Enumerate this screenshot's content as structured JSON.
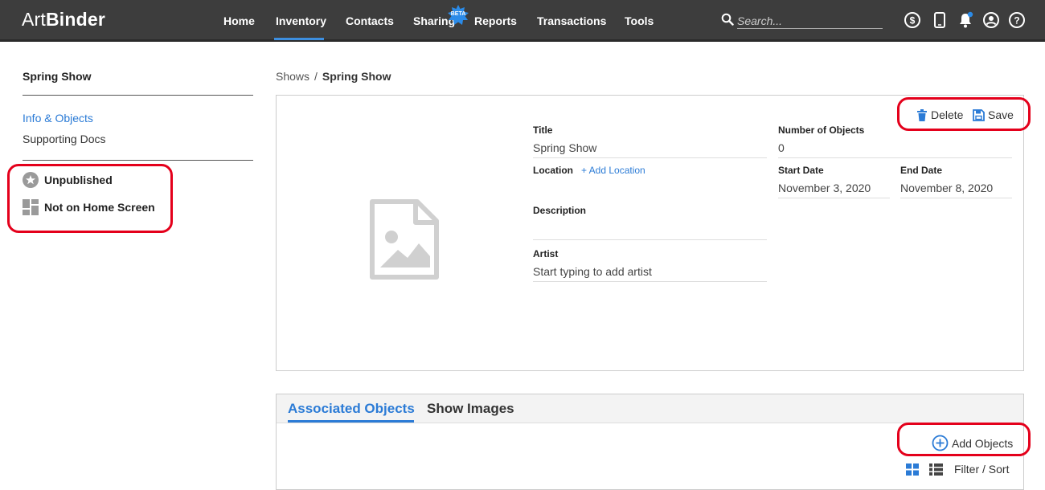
{
  "app": {
    "logo_light": "Art",
    "logo_bold": "Binder"
  },
  "nav": {
    "items": [
      {
        "label": "Home"
      },
      {
        "label": "Inventory"
      },
      {
        "label": "Contacts"
      },
      {
        "label": "Sharing"
      },
      {
        "label": "Reports"
      },
      {
        "label": "Transactions"
      },
      {
        "label": "Tools"
      }
    ],
    "active": "Inventory",
    "beta_badge": "BETA",
    "search_placeholder": "Search..."
  },
  "sidebar": {
    "title": "Spring Show",
    "links": [
      {
        "label": "Info & Objects"
      },
      {
        "label": "Supporting Docs"
      }
    ],
    "status": {
      "published": "Unpublished",
      "home_screen": "Not on Home Screen"
    }
  },
  "breadcrumb": {
    "parent": "Shows",
    "separator": "/",
    "current": "Spring Show"
  },
  "show": {
    "actions": {
      "delete": "Delete",
      "save": "Save"
    },
    "title_label": "Title",
    "title_value": "Spring Show",
    "location_label": "Location",
    "add_location": "+ Add Location",
    "description_label": "Description",
    "description_value": "",
    "artist_label": "Artist",
    "artist_placeholder": "Start typing to add artist",
    "objects_label": "Number of Objects",
    "objects_value": "0",
    "start_label": "Start Date",
    "start_value": "November  3, 2020",
    "end_label": "End Date",
    "end_value": "November  8, 2020"
  },
  "tabs": {
    "items": [
      {
        "label": "Associated Objects"
      },
      {
        "label": "Show Images"
      }
    ],
    "active": "Associated Objects",
    "add_objects": "Add Objects",
    "filter_sort": "Filter / Sort"
  },
  "colors": {
    "accent": "#2b7bd6",
    "topbar": "#3d3d3d",
    "highlight": "#e4001b"
  }
}
